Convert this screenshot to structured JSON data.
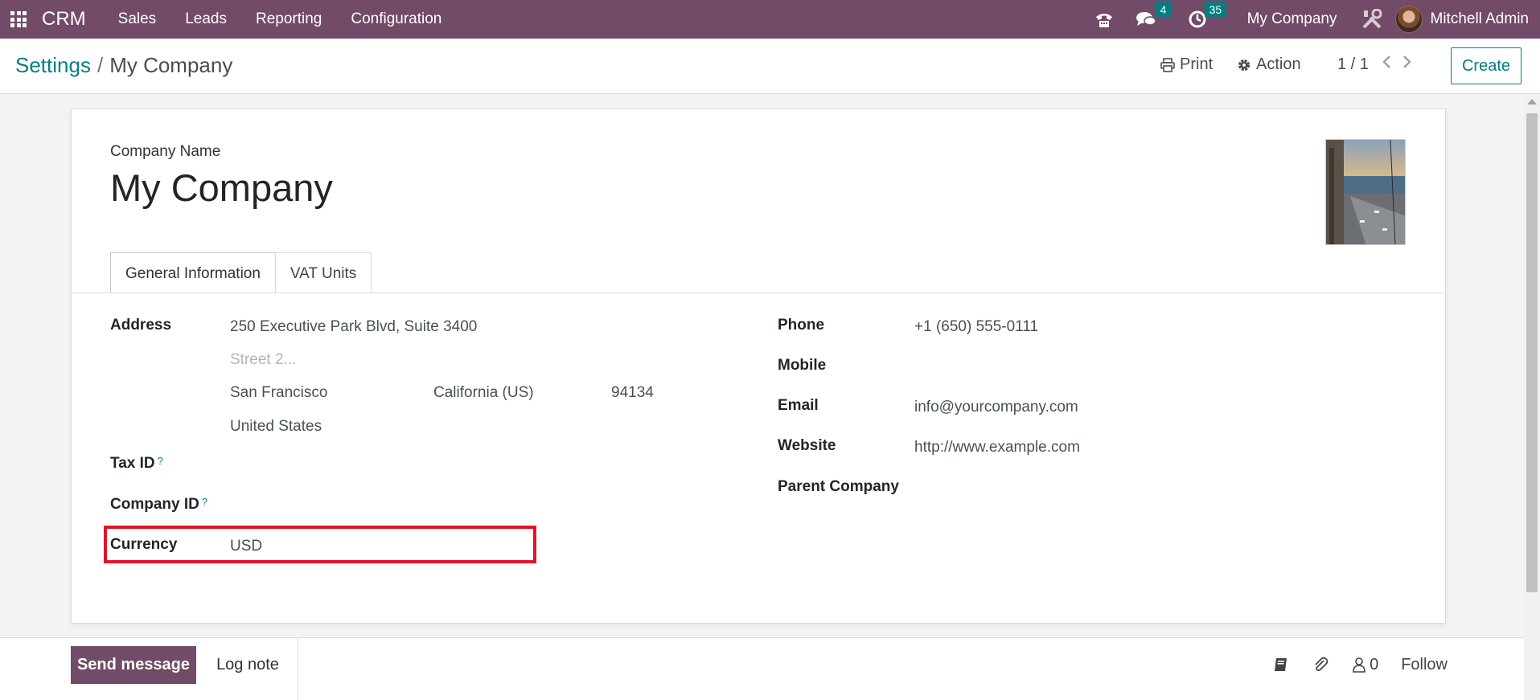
{
  "navbar": {
    "brand": "CRM",
    "menu": [
      "Sales",
      "Leads",
      "Reporting",
      "Configuration"
    ],
    "messages_count": "4",
    "activities_count": "35",
    "company": "My Company",
    "user": "Mitchell Admin",
    "bg_color": "#714b67",
    "badge_color": "#017e84"
  },
  "control_panel": {
    "breadcrumb_parent": "Settings",
    "breadcrumb_separator": "/",
    "breadcrumb_current": "My Company",
    "print_label": "Print",
    "action_label": "Action",
    "pager": "1 / 1",
    "create_label": "Create"
  },
  "form": {
    "company_name_label": "Company Name",
    "company_name": "My Company",
    "tabs": [
      "General Information",
      "VAT Units"
    ],
    "address_label": "Address",
    "street": "250 Executive Park Blvd, Suite 3400",
    "street2_placeholder": "Street 2...",
    "city": "San Francisco",
    "state": "California (US)",
    "zip": "94134",
    "country": "United States",
    "tax_id_label": "Tax ID",
    "company_id_label": "Company ID",
    "help_mark": "?",
    "currency_label": "Currency",
    "currency": "USD",
    "phone_label": "Phone",
    "phone": "+1 (650) 555-0111",
    "mobile_label": "Mobile",
    "email_label": "Email",
    "email": "info@yourcompany.com",
    "website_label": "Website",
    "website": "http://www.example.com",
    "parent_company_label": "Parent Company",
    "highlight_color": "#e0142a"
  },
  "chatter": {
    "send_message": "Send message",
    "log_note": "Log note",
    "followers_count": "0",
    "follow": "Follow"
  }
}
